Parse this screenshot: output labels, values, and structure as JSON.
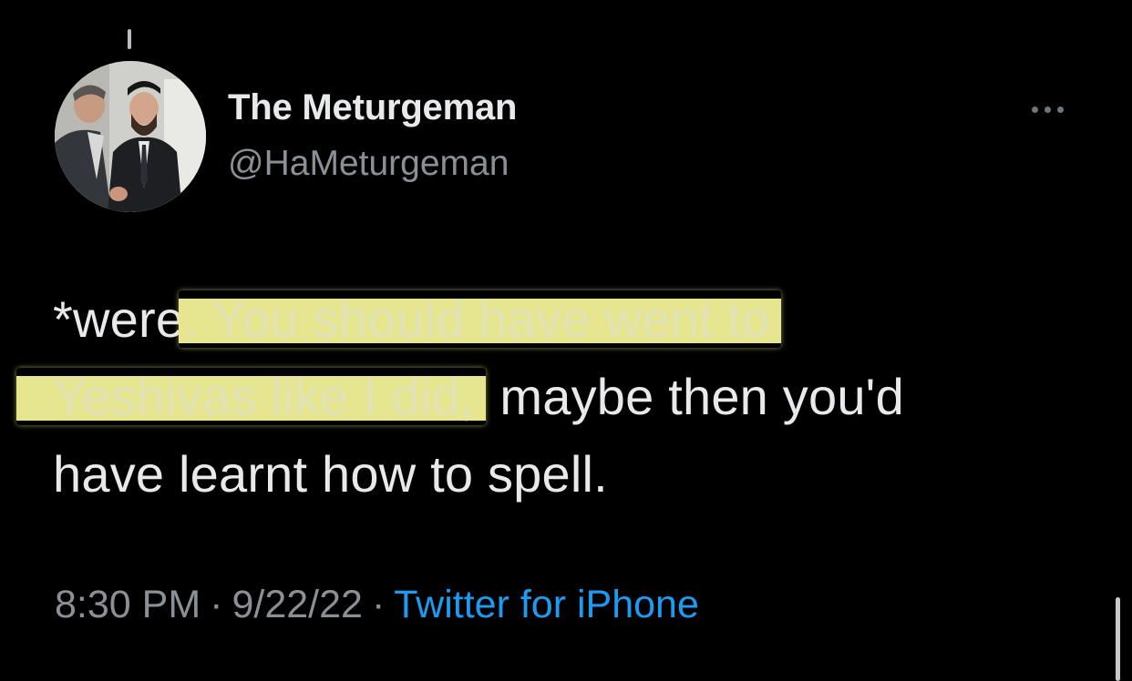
{
  "tweet": {
    "author": {
      "display_name": "The Meturgeman",
      "handle": "@HaMeturgeman"
    },
    "text": {
      "line1_plain": "*were",
      "line1_highlight": ". You should have went to",
      "line2_highlight": "Yeshivas like I did,",
      "line2_plain": " maybe then you'd",
      "line3_plain": "have learnt how to spell."
    },
    "meta": {
      "time": "8:30 PM",
      "sep1": "·",
      "date": "9/22/22",
      "sep2": "·",
      "source": "Twitter for iPhone"
    },
    "more_icon": "more-horizontal-icon"
  },
  "colors": {
    "background": "#000000",
    "text": "#e7e9ea",
    "secondary": "#8b9096",
    "link": "#1d9bf0",
    "highlight": "#e6e590"
  }
}
